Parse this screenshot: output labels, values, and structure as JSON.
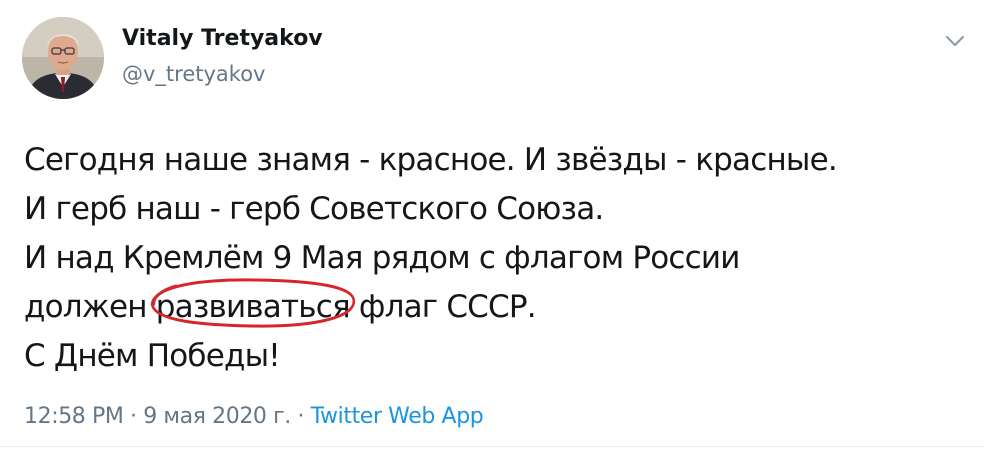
{
  "user": {
    "display_name": "Vitaly Tretyakov",
    "handle": "@v_tretyakov",
    "avatar_icon": "profile-photo"
  },
  "menu": {
    "icon": "chevron-down-icon"
  },
  "tweet": {
    "lines": [
      "Сегодня наше знамя - красное. И звёзды - красные.",
      "И герб наш - герб Советского Союза.",
      "И над Кремлём 9 Мая рядом с флагом России"
    ],
    "line4_before": "должен",
    "line4_circled": "развиваться",
    "line4_after": "флаг СССР.",
    "line5": "С Днём Победы!"
  },
  "meta": {
    "time": "12:58 PM",
    "separator": "·",
    "date": "9 мая 2020 г.",
    "source": "Twitter Web App"
  },
  "colors": {
    "text": "#14171a",
    "secondary": "#657786",
    "link": "#1b95e0",
    "circle": "#d7262b"
  }
}
